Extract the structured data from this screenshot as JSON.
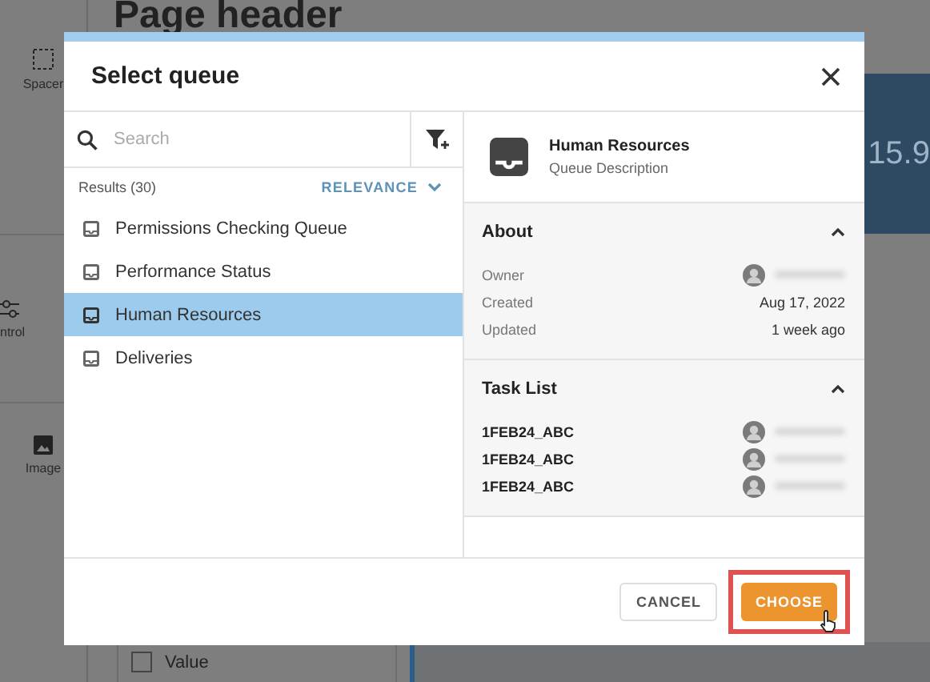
{
  "background": {
    "page_header": "Page header",
    "sidebar_items": [
      {
        "label": "Spacer",
        "kind": "spacer"
      },
      {
        "label": "ntrol",
        "kind": "control"
      },
      {
        "label": "Image",
        "kind": "image"
      }
    ],
    "metric": "15.9",
    "checkbox": {
      "label": "Value",
      "checked": false
    }
  },
  "dialog": {
    "title": "Select queue",
    "search": {
      "placeholder": "Search"
    },
    "results_label": "Results (30)",
    "sort": "RELEVANCE",
    "queues": [
      {
        "label": "Permissions Checking Queue",
        "selected": false
      },
      {
        "label": "Performance Status",
        "selected": false
      },
      {
        "label": "Human Resources",
        "selected": true
      },
      {
        "label": "Deliveries",
        "selected": false
      }
    ],
    "detail": {
      "name": "Human Resources",
      "description": "Queue Description",
      "sections": [
        {
          "title": "About",
          "expanded": true,
          "kind": "fields",
          "rows": [
            {
              "label": "Owner",
              "kind": "person"
            },
            {
              "label": "Created",
              "value": "Aug 17, 2022",
              "kind": "text"
            },
            {
              "label": "Updated",
              "value": "1 week ago",
              "kind": "text"
            }
          ]
        },
        {
          "title": "Task List",
          "expanded": true,
          "kind": "tasks",
          "rows": [
            {
              "label": "1FEB24_ABC",
              "kind": "person"
            },
            {
              "label": "1FEB24_ABC",
              "kind": "person"
            },
            {
              "label": "1FEB24_ABC",
              "kind": "person"
            }
          ]
        }
      ]
    },
    "buttons": [
      {
        "label": "CANCEL",
        "kind": "secondary",
        "highlighted": false
      },
      {
        "label": "CHOOSE",
        "kind": "primary",
        "highlighted": true
      }
    ]
  }
}
